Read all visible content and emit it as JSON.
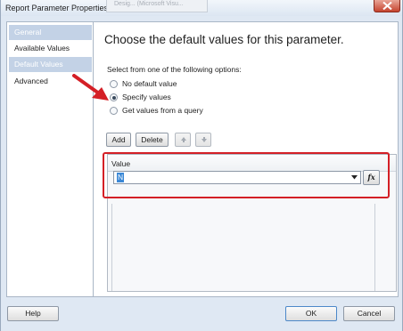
{
  "window": {
    "title": "Report Parameter Properties",
    "background_tab_label": "Desig... (Microsoft Visu...",
    "close_icon": "close-icon"
  },
  "sidebar": {
    "items": [
      {
        "label": "General",
        "state": "highlighted"
      },
      {
        "label": "Available Values",
        "state": "normal"
      },
      {
        "label": "Default Values",
        "state": "selected"
      },
      {
        "label": "Advanced",
        "state": "normal"
      }
    ]
  },
  "main": {
    "heading": "Choose the default values for this parameter.",
    "options_label": "Select from one of the following options:",
    "options": [
      {
        "label": "No default value",
        "checked": false
      },
      {
        "label": "Specify values",
        "checked": true
      },
      {
        "label": "Get values from a query",
        "checked": false
      }
    ],
    "toolbar": {
      "add_label": "Add",
      "delete_label": "Delete",
      "move_up_icon": "arrow-up-icon",
      "move_down_icon": "arrow-down-icon"
    },
    "grid": {
      "column_header": "Value",
      "rows": [
        {
          "value": "N"
        }
      ],
      "expression_button_label": "fx"
    }
  },
  "footer": {
    "help_label": "Help",
    "ok_label": "OK",
    "cancel_label": "Cancel"
  },
  "colors": {
    "annotation_red": "#d41f26",
    "selection_blue": "#3b88d6",
    "sidebar_selected": "#c3d2e6",
    "window_bg": "#dfe8f3"
  }
}
